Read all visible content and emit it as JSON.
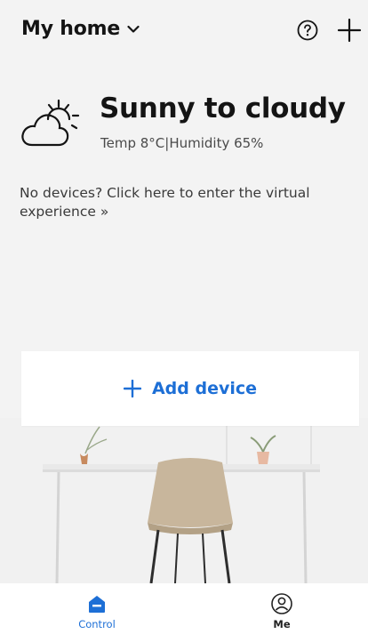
{
  "header": {
    "home_name": "My home",
    "icons": [
      "chevron-down-icon",
      "help-icon",
      "plus-icon"
    ]
  },
  "weather": {
    "condition": "Sunny to cloudy",
    "details": "Temp 8°C|Humidity 65%",
    "icon": "sun-behind-cloud-icon"
  },
  "virtual_experience": {
    "text": "No devices? Click here to enter the virtual experience »"
  },
  "add_device": {
    "label": "Add device"
  },
  "bottom_nav": {
    "items": [
      {
        "label": "Control",
        "icon": "home-icon",
        "active": true
      },
      {
        "label": "Me",
        "icon": "profile-icon",
        "active": false
      }
    ]
  },
  "colors": {
    "accent": "#1d6fd6",
    "background": "#f3f3f3",
    "card": "#ffffff"
  }
}
